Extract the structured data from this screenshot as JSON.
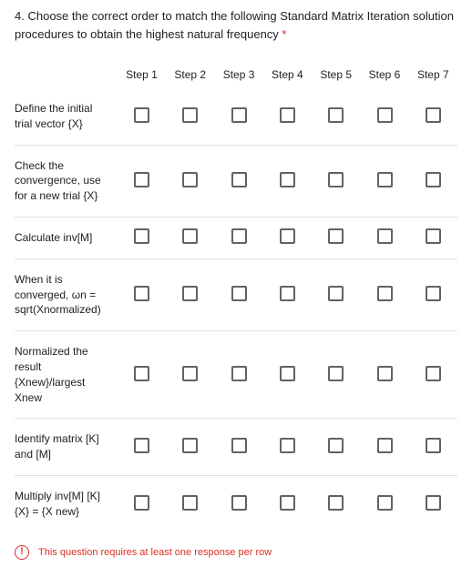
{
  "question": {
    "number_prefix": "4. ",
    "text": "Choose the correct order to match the following Standard Matrix Iteration solution procedures to obtain the highest natural frequency",
    "required_marker": " *"
  },
  "columns": [
    "Step 1",
    "Step 2",
    "Step 3",
    "Step 4",
    "Step 5",
    "Step 6",
    "Step 7"
  ],
  "rows": [
    {
      "label": "Define the initial trial vector {X}"
    },
    {
      "label": "Check the convergence, use for a new trial {X}"
    },
    {
      "label": "Calculate inv[M]"
    },
    {
      "label": "When it is converged, ωn = sqrt(Xnormalized)"
    },
    {
      "label": "Normalized the result {Xnew}/largest Xnew"
    },
    {
      "label": "Identify matrix [K] and [M]"
    },
    {
      "label": "Multiply inv[M] [K] {X} = {X new}"
    }
  ],
  "validation": {
    "icon_glyph": "!",
    "message": "This question requires at least one response per row"
  }
}
